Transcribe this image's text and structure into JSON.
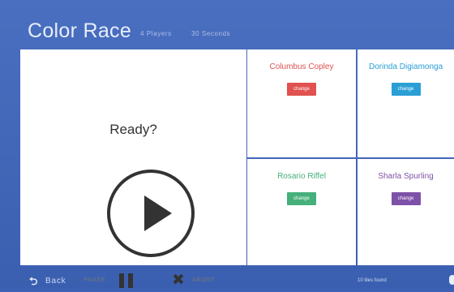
{
  "header": {
    "title": "Color Race",
    "players": "4 Players",
    "seconds": "30 Seconds"
  },
  "main": {
    "ready": "Ready?",
    "pause_label": "PAUSE",
    "abort_label": "ABORT",
    "icons": {
      "play": "play-icon",
      "pause": "pause-icon",
      "abort": "close-icon"
    }
  },
  "players": [
    {
      "name": "Columbus Copley",
      "button": "change",
      "color": "#e0524f"
    },
    {
      "name": "Dorinda Digiamonga",
      "button": "change",
      "color": "#2a9fd6"
    },
    {
      "name": "Rosario Riffel",
      "button": "change",
      "color": "#45b07a"
    },
    {
      "name": "Sharla Spurling",
      "button": "change",
      "color": "#7d51a8"
    }
  ],
  "footer": {
    "back_label": "Back",
    "tiles_found": "10 tiles found",
    "icons": {
      "back": "back-arrow-icon"
    }
  },
  "colors": {
    "background": "#3d62b3",
    "panel": "#ffffff",
    "text": "#333333"
  }
}
